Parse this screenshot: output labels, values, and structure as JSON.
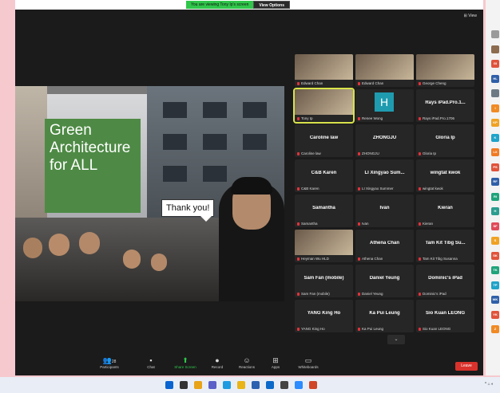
{
  "colors": {
    "zoom_bg": "#1b1b1b",
    "banner_green": "#2fc64a",
    "leave_red": "#d9322c",
    "active_tile": "#d7e34a",
    "slide_green": "#4e8a45"
  },
  "banner": {
    "message": "You are viewing Tony Ip's screen",
    "view_options": "View Options"
  },
  "view_button": "View",
  "shared_screen": {
    "slide_title": "Green Architecture for ALL",
    "bubble": "Thank you!"
  },
  "gallery": {
    "tiles": [
      {
        "name": "",
        "caption": "Edward Chan",
        "video": true
      },
      {
        "name": "",
        "caption": "Edward Chan",
        "video": true
      },
      {
        "name": "",
        "caption": "George Cheng",
        "video": true
      },
      {
        "name": "",
        "caption": "Tony Ip",
        "video": true,
        "active": true
      },
      {
        "name": "H",
        "caption": "Renee Wong",
        "avatar": true
      },
      {
        "name": "Rays iPad.Pro.1...",
        "caption": "Rays iPad.Pro.1706"
      },
      {
        "name": "Caroline law",
        "caption": "Caroline law"
      },
      {
        "name": "ZHONGJU",
        "caption": "ZHONGJU"
      },
      {
        "name": "Gloria Ip",
        "caption": "Gloria Ip"
      },
      {
        "name": "C&B Karen",
        "caption": "C&B Karen"
      },
      {
        "name": "LI Xingyao Sum...",
        "caption": "LI Xingyao Summer"
      },
      {
        "name": "wingtat kwok",
        "caption": "wingtat kwok"
      },
      {
        "name": "Samantha",
        "caption": "Samantha"
      },
      {
        "name": "Ivan",
        "caption": "Ivan"
      },
      {
        "name": "Kieran",
        "caption": "Kieran"
      },
      {
        "name": "",
        "caption": "Heyman Wu HLD",
        "video": true
      },
      {
        "name": "Athena Chan",
        "caption": "Athena Chan"
      },
      {
        "name": "Tam Kit Tibg Su...",
        "caption": "Tam Kit Tibg Susanna"
      },
      {
        "name": "Sam Fan (mobile)",
        "caption": "Sam Fan (mobile)"
      },
      {
        "name": "Daniel Yeung",
        "caption": "Daniel Yeung"
      },
      {
        "name": "Dominic's iPad",
        "caption": "Dominic's iPad"
      },
      {
        "name": "YANG King Ho",
        "caption": "YANG King Ho"
      },
      {
        "name": "Ka Pui Leung",
        "caption": "Ka Pui Leung"
      },
      {
        "name": "Sio Kuan LEONG",
        "caption": "Sio Kuan LEONG"
      }
    ]
  },
  "toolbar": {
    "participants_count": "28",
    "participants": "Participants",
    "chat": "Chat",
    "share_screen": "Share Screen",
    "record": "Record",
    "reactions": "Reactions",
    "apps": "Apps",
    "whiteboards": "Whiteboards",
    "leave": "Leave"
  },
  "side_avatars": [
    {
      "t": "",
      "c": "#9a9a9a"
    },
    {
      "t": "",
      "c": "#8c6b4f"
    },
    {
      "t": "GI",
      "c": "#e0533c"
    },
    {
      "t": "HL",
      "c": "#2f5fa8"
    },
    {
      "t": "",
      "c": "#6d7a86"
    },
    {
      "t": "I",
      "c": "#f08a24"
    },
    {
      "t": "KP",
      "c": "#f0a224"
    },
    {
      "t": "K",
      "c": "#1fa3c9"
    },
    {
      "t": "LX",
      "c": "#f07b24"
    },
    {
      "t": "PS",
      "c": "#e0533c"
    },
    {
      "t": "RF",
      "c": "#2f5fa8"
    },
    {
      "t": "RI",
      "c": "#1fa37a"
    },
    {
      "t": "H",
      "c": "#2a9d8f"
    },
    {
      "t": "SF",
      "c": "#e04a5a"
    },
    {
      "t": "S",
      "c": "#f0a224"
    },
    {
      "t": "SK",
      "c": "#e0533c"
    },
    {
      "t": "TK",
      "c": "#1fa37a"
    },
    {
      "t": "TP",
      "c": "#1fa3c9"
    },
    {
      "t": "WK",
      "c": "#2f5fa8"
    },
    {
      "t": "YK",
      "c": "#e0533c"
    },
    {
      "t": "Z",
      "c": "#f08a24"
    }
  ],
  "taskbar_icons": [
    "windows",
    "search",
    "explorer",
    "chat",
    "edge",
    "folder",
    "word",
    "outlook",
    "store",
    "zoom",
    "powerpoint"
  ]
}
